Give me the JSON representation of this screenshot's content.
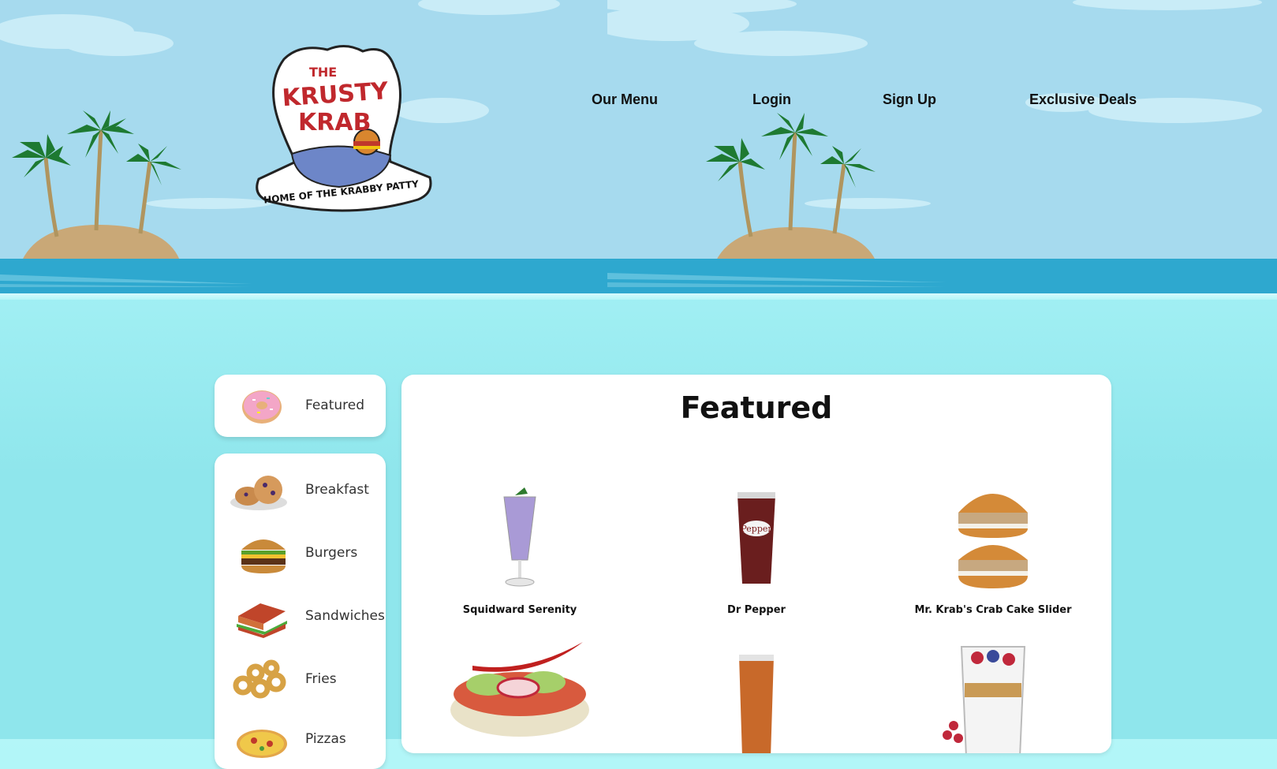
{
  "brand": {
    "logo_top": "THE",
    "logo_line1": "KRUSTY",
    "logo_line2": "KRAB",
    "logo_tagline": "HOME OF THE KRABBY PATTY"
  },
  "nav": {
    "items": [
      "Our Menu",
      "Login",
      "Sign Up",
      "Exclusive Deals"
    ]
  },
  "sidebar": {
    "featured": "Featured",
    "categories": [
      "Breakfast",
      "Burgers",
      "Sandwiches",
      "Fries",
      "Pizzas"
    ]
  },
  "main": {
    "title": "Featured",
    "items": [
      {
        "name": "Squidward Serenity"
      },
      {
        "name": "Dr Pepper"
      },
      {
        "name": "Mr. Krab's Crab Cake Slider"
      },
      {
        "name": ""
      },
      {
        "name": ""
      },
      {
        "name": ""
      }
    ]
  },
  "colors": {
    "sky": "#a6daee",
    "sea": "#2ea8cf",
    "page_bg": "#a7f2f6",
    "card": "#ffffff"
  }
}
